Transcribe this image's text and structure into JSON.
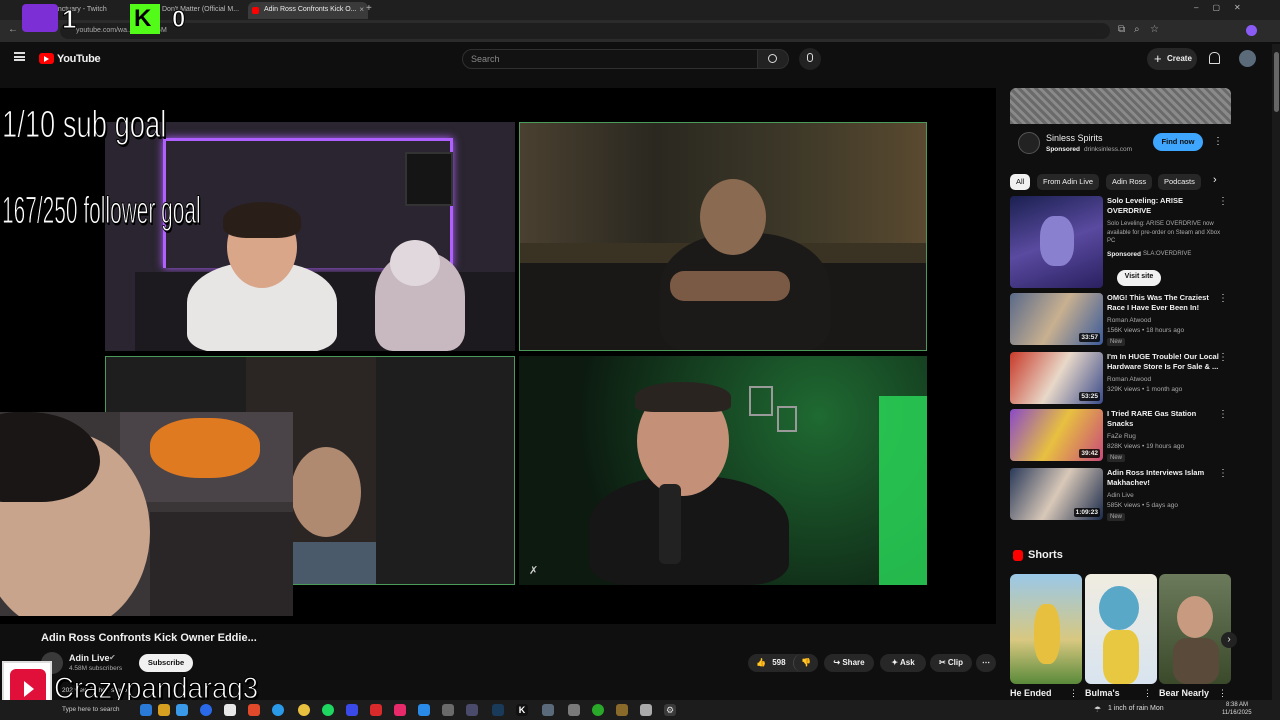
{
  "browser": {
    "tabs": [
      {
        "label": "vonSanctuary - Twitch"
      },
      {
        "label": "Don't Matter (Official M..."
      },
      {
        "label": "Adin Ross Confronts Kick O..."
      }
    ],
    "url": "youtube.com/wa...TruBhoGM"
  },
  "stream_overlay": {
    "counter_left": "1",
    "counter_right": "0",
    "sub_goal": "1/10 sub goal",
    "follower_goal": "167/250 follower goal",
    "username": "Crazypandarag3"
  },
  "header": {
    "logo_text": "YouTube",
    "search_placeholder": "Search",
    "create_label": "Create"
  },
  "video": {
    "title": "Adin Ross Confronts Kick Owner Eddie...",
    "channel": "Adin Live",
    "subscribers": "4.58M subscribers",
    "subscribe_label": "Subscribe",
    "views_partial": "202 view  20 hou s ago",
    "likes": "598",
    "share_label": "Share",
    "ask_label": "Ask",
    "clip_label": "Clip"
  },
  "ad": {
    "name": "Sinless Spirits",
    "sponsored": "Sponsored",
    "domain": "drinksinless.com",
    "cta": "Find now"
  },
  "chips": [
    "All",
    "From Adin Live",
    "Adin Ross",
    "Podcasts"
  ],
  "recommendations": [
    {
      "title": "Solo Leveling: ARISE OVERDRIVE",
      "desc": "Solo Leveling: ARISE OVERDRIVE now available for pre-order on Steam and Xbox PC",
      "sponsored": "Sponsored",
      "advertiser": "SLA:OVERDRIVE",
      "cta": "Visit site"
    },
    {
      "title": "OMG! This Was The Craziest Race I Have Ever Been In! Luck...",
      "channel": "Roman Atwood",
      "meta": "156K views • 18 hours ago",
      "badge": "New",
      "duration": "33:57"
    },
    {
      "title": "I'm In HUGE Trouble! Our Local Hardware Store Is For Sale & ...",
      "channel": "Roman Atwood",
      "meta": "329K views • 1 month ago",
      "duration": "53:25"
    },
    {
      "title": "I Tried RARE Gas Station Snacks",
      "channel": "FaZe Rug",
      "meta": "828K views • 19 hours ago",
      "badge": "New",
      "duration": "39:42"
    },
    {
      "title": "Adin Ross Interviews Islam Makhachev!",
      "channel": "Adin Live",
      "meta": "585K views • 5 days ago",
      "badge": "New",
      "duration": "1:09:23"
    }
  ],
  "shorts": {
    "heading": "Shorts",
    "items": [
      {
        "title": "He Ended"
      },
      {
        "title": "Bulma's"
      },
      {
        "title": "Bear Nearly"
      }
    ]
  },
  "taskbar": {
    "search_placeholder": "Type here to search",
    "weather": "1 inch of rain Mon",
    "time": "8:38 AM",
    "date": "11/16/2025"
  },
  "colors": {
    "bg": "#0f0f0f",
    "accent_blue": "#3ea6ff",
    "youtube_red": "#ff0000",
    "kick_green": "#53fc18",
    "twitch_purple": "#9146ff"
  }
}
